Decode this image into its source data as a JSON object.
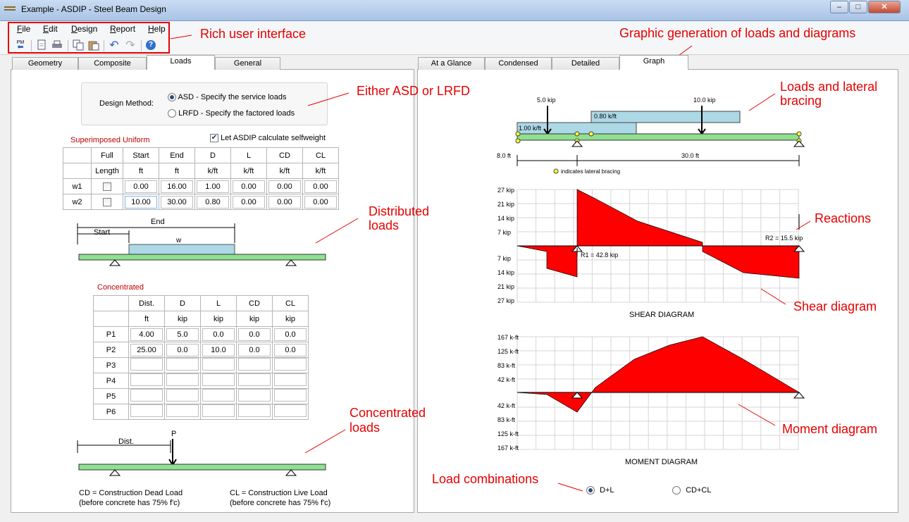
{
  "window": {
    "title": "Example - ASDIP - Steel Beam Design",
    "min": "–",
    "max": "□",
    "close": "✕"
  },
  "menu": [
    {
      "first": "F",
      "rest": "ile"
    },
    {
      "first": "E",
      "rest": "dit"
    },
    {
      "first": "D",
      "rest": "esign"
    },
    {
      "first": "R",
      "rest": "eport"
    },
    {
      "first": "H",
      "rest": "elp"
    }
  ],
  "toolbar": {
    "pm_label": "PM",
    "icons": [
      "back-icon",
      "new-icon",
      "print-icon",
      "copy-icon",
      "paste-icon",
      "undo-icon",
      "redo-icon",
      "help-icon"
    ]
  },
  "left_tabs": [
    "Geometry",
    "Composite",
    "Loads",
    "General"
  ],
  "right_tabs": [
    "At a Glance",
    "Condensed",
    "Detailed",
    "Graph"
  ],
  "design_method": {
    "label": "Design Method:",
    "asd": "ASD - Specify the service loads",
    "lrfd": "LRFD - Specify the factored loads",
    "selected": "ASD"
  },
  "selfweight": {
    "label": "Let ASDIP calculate selfweight",
    "checked": true
  },
  "uniform": {
    "title": "Superimposed Uniform",
    "headers": [
      "Full",
      "Start",
      "End",
      "D",
      "L",
      "CD",
      "CL"
    ],
    "units": [
      "Length",
      "ft",
      "ft",
      "k/ft",
      "k/ft",
      "k/ft",
      "k/ft"
    ],
    "rows": [
      {
        "name": "w1",
        "vals": [
          "0.00",
          "16.00",
          "1.00",
          "0.00",
          "0.00",
          "0.00"
        ]
      },
      {
        "name": "w2",
        "vals": [
          "10.00",
          "30.00",
          "0.80",
          "0.00",
          "0.00",
          "0.00"
        ]
      }
    ]
  },
  "dist_diagram": {
    "end": "End",
    "start": "Start",
    "w": "w"
  },
  "concentrated": {
    "title": "Concentrated",
    "headers": [
      "Dist.",
      "D",
      "L",
      "CD",
      "CL"
    ],
    "units": [
      "ft",
      "kip",
      "kip",
      "kip",
      "kip"
    ],
    "rows": [
      {
        "name": "P1",
        "vals": [
          "4.00",
          "5.0",
          "0.0",
          "0.0",
          "0.0"
        ]
      },
      {
        "name": "P2",
        "vals": [
          "25.00",
          "0.0",
          "10.0",
          "0.0",
          "0.0"
        ]
      },
      {
        "name": "P3",
        "vals": [
          "",
          "",
          "",
          "",
          ""
        ]
      },
      {
        "name": "P4",
        "vals": [
          "",
          "",
          "",
          "",
          ""
        ]
      },
      {
        "name": "P5",
        "vals": [
          "",
          "",
          "",
          "",
          ""
        ]
      },
      {
        "name": "P6",
        "vals": [
          "",
          "",
          "",
          "",
          ""
        ]
      }
    ]
  },
  "conc_diagram": {
    "dist": "Dist.",
    "p": "P"
  },
  "notes": {
    "cd": "CD = Construction Dead Load",
    "cd_sub": "(before concrete has 75% f'c)",
    "cl": "CL = Construction Live Load",
    "cl_sub": "(before concrete has 75% f'c)"
  },
  "loads_graph": {
    "p1": "5.0 kip",
    "p2": "10.0 kip",
    "w1": "1.00 k/ft",
    "w2": "0.80 k/ft",
    "dim_left": "8.0 ft",
    "dim_span": "30.0 ft",
    "bracing_note": "indicates lateral bracing"
  },
  "shear": {
    "title": "SHEAR DIAGRAM",
    "ticks_pos": [
      "27 kip",
      "21 kip",
      "14 kip",
      "7 kip"
    ],
    "ticks_neg": [
      "7 kip",
      "14 kip",
      "21 kip",
      "27 kip"
    ],
    "r1": "R1 = 42.8 kip",
    "r2": "R2 = 15.5 kip"
  },
  "moment": {
    "title": "MOMENT DIAGRAM",
    "ticks_pos": [
      "167 k-ft",
      "125 k-ft",
      "83 k-ft",
      "42 k-ft"
    ],
    "ticks_neg": [
      "42 k-ft",
      "83 k-ft",
      "125 k-ft",
      "167 k-ft"
    ]
  },
  "combos": {
    "a": "D+L",
    "b": "CD+CL",
    "selected": "D+L"
  },
  "annotations": {
    "rich_ui": "Rich user interface",
    "graphic": "Graphic generation of loads and diagrams",
    "asd_lrfd": "Either ASD or LRFD",
    "lateral1": "Loads and lateral",
    "lateral2": "bracing",
    "distributed1": "Distributed",
    "distributed2": "loads",
    "reactions": "Reactions",
    "shear": "Shear diagram",
    "concentrated1": "Concentrated",
    "concentrated2": "loads",
    "moment": "Moment diagram",
    "combos": "Load combinations"
  },
  "colors": {
    "accent_red": "#e60000",
    "beam_green": "#90e090",
    "load_blue": "#add8e6",
    "diagram_red": "#ff0000"
  }
}
